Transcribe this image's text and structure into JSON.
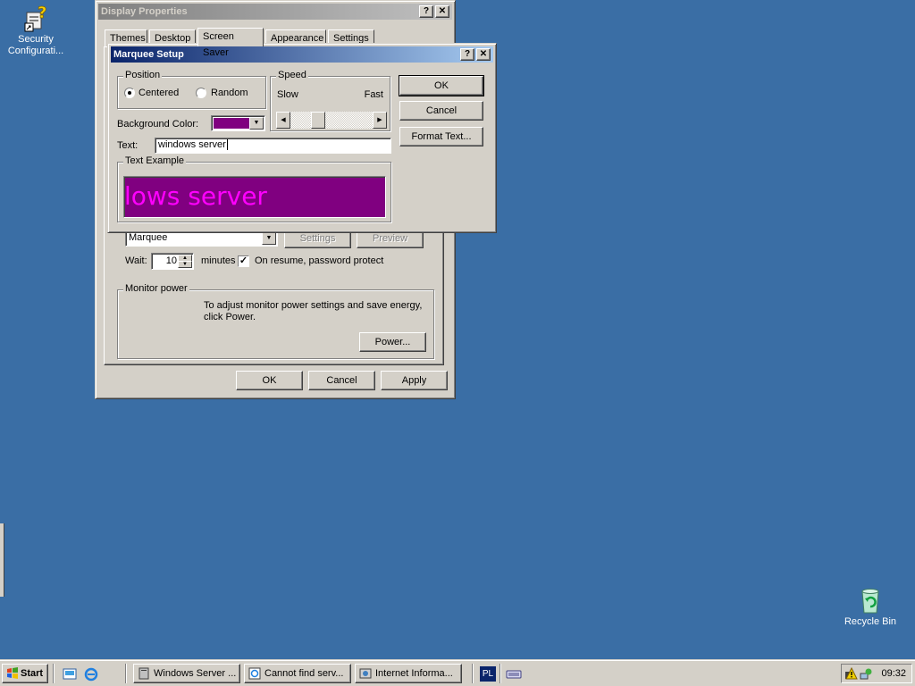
{
  "desktop": {
    "icons": [
      {
        "label": "Security Configurati..."
      },
      {
        "label": "Recycle Bin"
      }
    ]
  },
  "display_properties": {
    "title": "Display Properties",
    "tabs": [
      "Themes",
      "Desktop",
      "Screen Saver",
      "Appearance",
      "Settings"
    ],
    "screen_saver": {
      "selected": "Marquee",
      "settings_label": "Settings",
      "preview_label": "Preview",
      "wait_label": "Wait:",
      "wait_value": "10",
      "minutes_label": "minutes",
      "password_label": "On resume, password protect",
      "password_checked": true
    },
    "monitor_power": {
      "title": "Monitor power",
      "description": "To adjust monitor power settings and save energy, click Power.",
      "power_button": "Power..."
    },
    "buttons": {
      "ok": "OK",
      "cancel": "Cancel",
      "apply": "Apply"
    }
  },
  "marquee_setup": {
    "title": "Marquee Setup",
    "position": {
      "label": "Position",
      "options": [
        "Centered",
        "Random"
      ],
      "selected": "Centered"
    },
    "speed": {
      "label": "Speed",
      "slow": "Slow",
      "fast": "Fast",
      "level": 0.3
    },
    "background_color_label": "Background Color:",
    "background_color": "#800080",
    "text_label": "Text:",
    "text_value": "windows server",
    "text_example_label": "Text Example",
    "example_text": "lows server",
    "example_text_color": "#ff00ff",
    "buttons": {
      "ok": "OK",
      "cancel": "Cancel",
      "format_text": "Format Text..."
    }
  },
  "taskbar": {
    "start_label": "Start",
    "tasks": [
      {
        "label": "Windows Server ..."
      },
      {
        "label": "Cannot find serv..."
      },
      {
        "label": "Internet Informa..."
      }
    ],
    "language": "PL",
    "clock": "09:32"
  },
  "colors": {
    "desktop": "#3a6ea5",
    "title_active": "#0a246a",
    "face": "#d4d0c8"
  }
}
